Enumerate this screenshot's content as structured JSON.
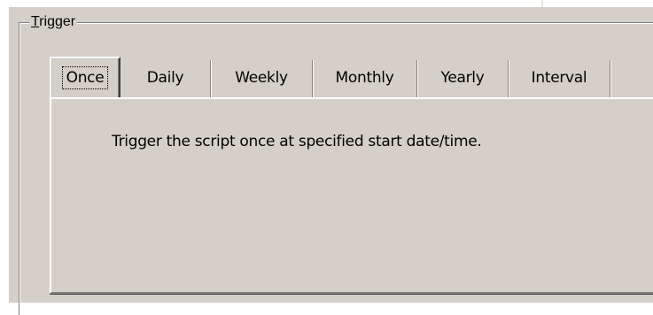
{
  "trigger_group": {
    "mnemonic": "T",
    "label_rest": "rigger"
  },
  "tabs": [
    {
      "label": "Once",
      "selected": true
    },
    {
      "label": "Daily",
      "selected": false
    },
    {
      "label": "Weekly",
      "selected": false
    },
    {
      "label": "Monthly",
      "selected": false
    },
    {
      "label": "Yearly",
      "selected": false
    },
    {
      "label": "Interval",
      "selected": false
    }
  ],
  "tab_page": {
    "description": "Trigger the script once at specified start date/time."
  },
  "colors": {
    "face": "#d4d0c8",
    "highlight": "#ffffff",
    "shadow": "#808080",
    "dark_shadow": "#404040"
  }
}
